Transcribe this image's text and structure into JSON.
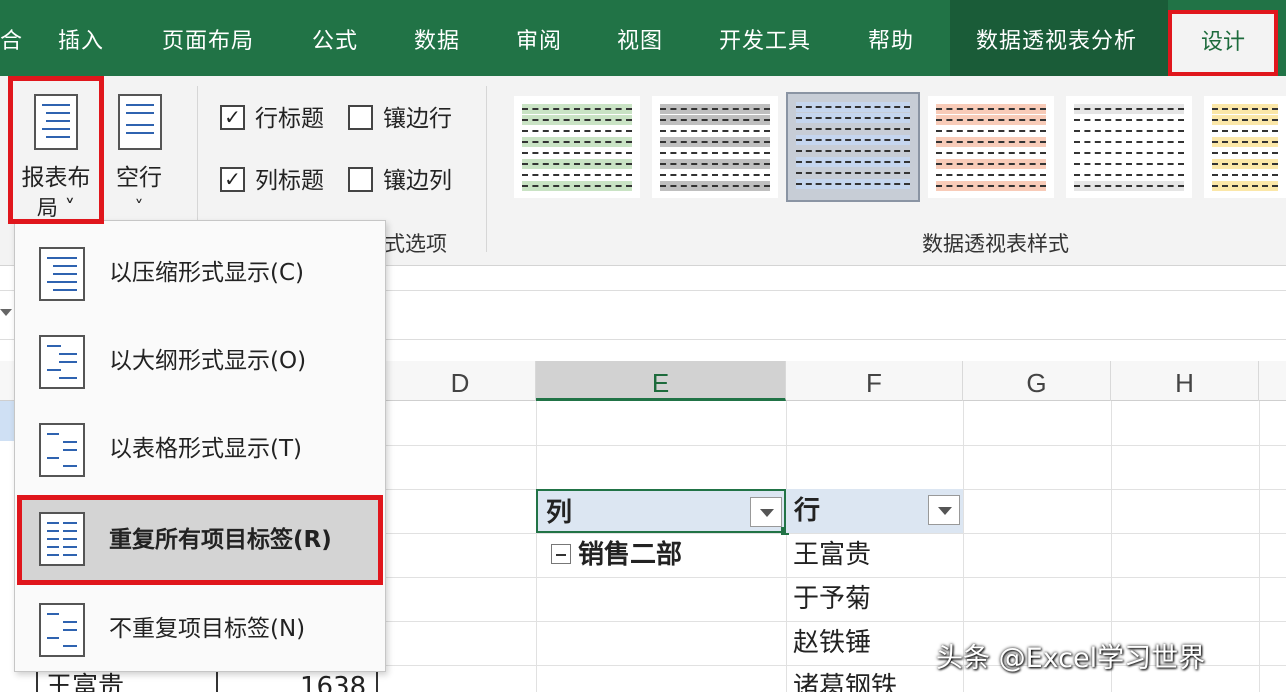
{
  "tabs": [
    {
      "label": "插入"
    },
    {
      "label": "页面布局"
    },
    {
      "label": "公式"
    },
    {
      "label": "数据"
    },
    {
      "label": "审阅"
    },
    {
      "label": "视图"
    },
    {
      "label": "开发工具"
    },
    {
      "label": "帮助"
    },
    {
      "label": "数据透视表分析"
    },
    {
      "label": "设计"
    }
  ],
  "ribbon": {
    "report_layout": {
      "line1": "报表布",
      "line2": "局 ˅"
    },
    "blank_rows": {
      "line1": "空行",
      "line2": "˅"
    },
    "options": {
      "row_headers": {
        "label": "行标题",
        "checked": true
      },
      "col_headers": {
        "label": "列标题",
        "checked": true
      },
      "banded_rows": {
        "label": "镶边行",
        "checked": false
      },
      "banded_cols": {
        "label": "镶边列",
        "checked": false
      },
      "group_label_tail": "式选项"
    },
    "styles_group_label": "数据透视表样式",
    "style_colors": [
      "#c9e3c4",
      "#bfbfbf",
      "#c5d6ef",
      "#f8cbb8",
      "#e5e5e5",
      "#fbe7a8"
    ]
  },
  "menu": {
    "items": [
      {
        "label": "以压缩形式显示(C)"
      },
      {
        "label": "以大纲形式显示(O)"
      },
      {
        "label": "以表格形式显示(T)"
      },
      {
        "label": "重复所有项目标签(R)"
      },
      {
        "label": "不重复项目标签(N)"
      }
    ]
  },
  "grid": {
    "columns": [
      "D",
      "E",
      "F",
      "G",
      "H"
    ],
    "selected_column": "E",
    "pivot": {
      "col_header": "列",
      "row_header": "行",
      "group": "销售二部",
      "names": [
        "王富贵",
        "于予菊",
        "赵铁锤",
        "诸葛钢铁"
      ]
    },
    "left_partial": {
      "name": "王富贵",
      "value": "1638"
    }
  },
  "watermark": "头条 @Excel学习世界"
}
